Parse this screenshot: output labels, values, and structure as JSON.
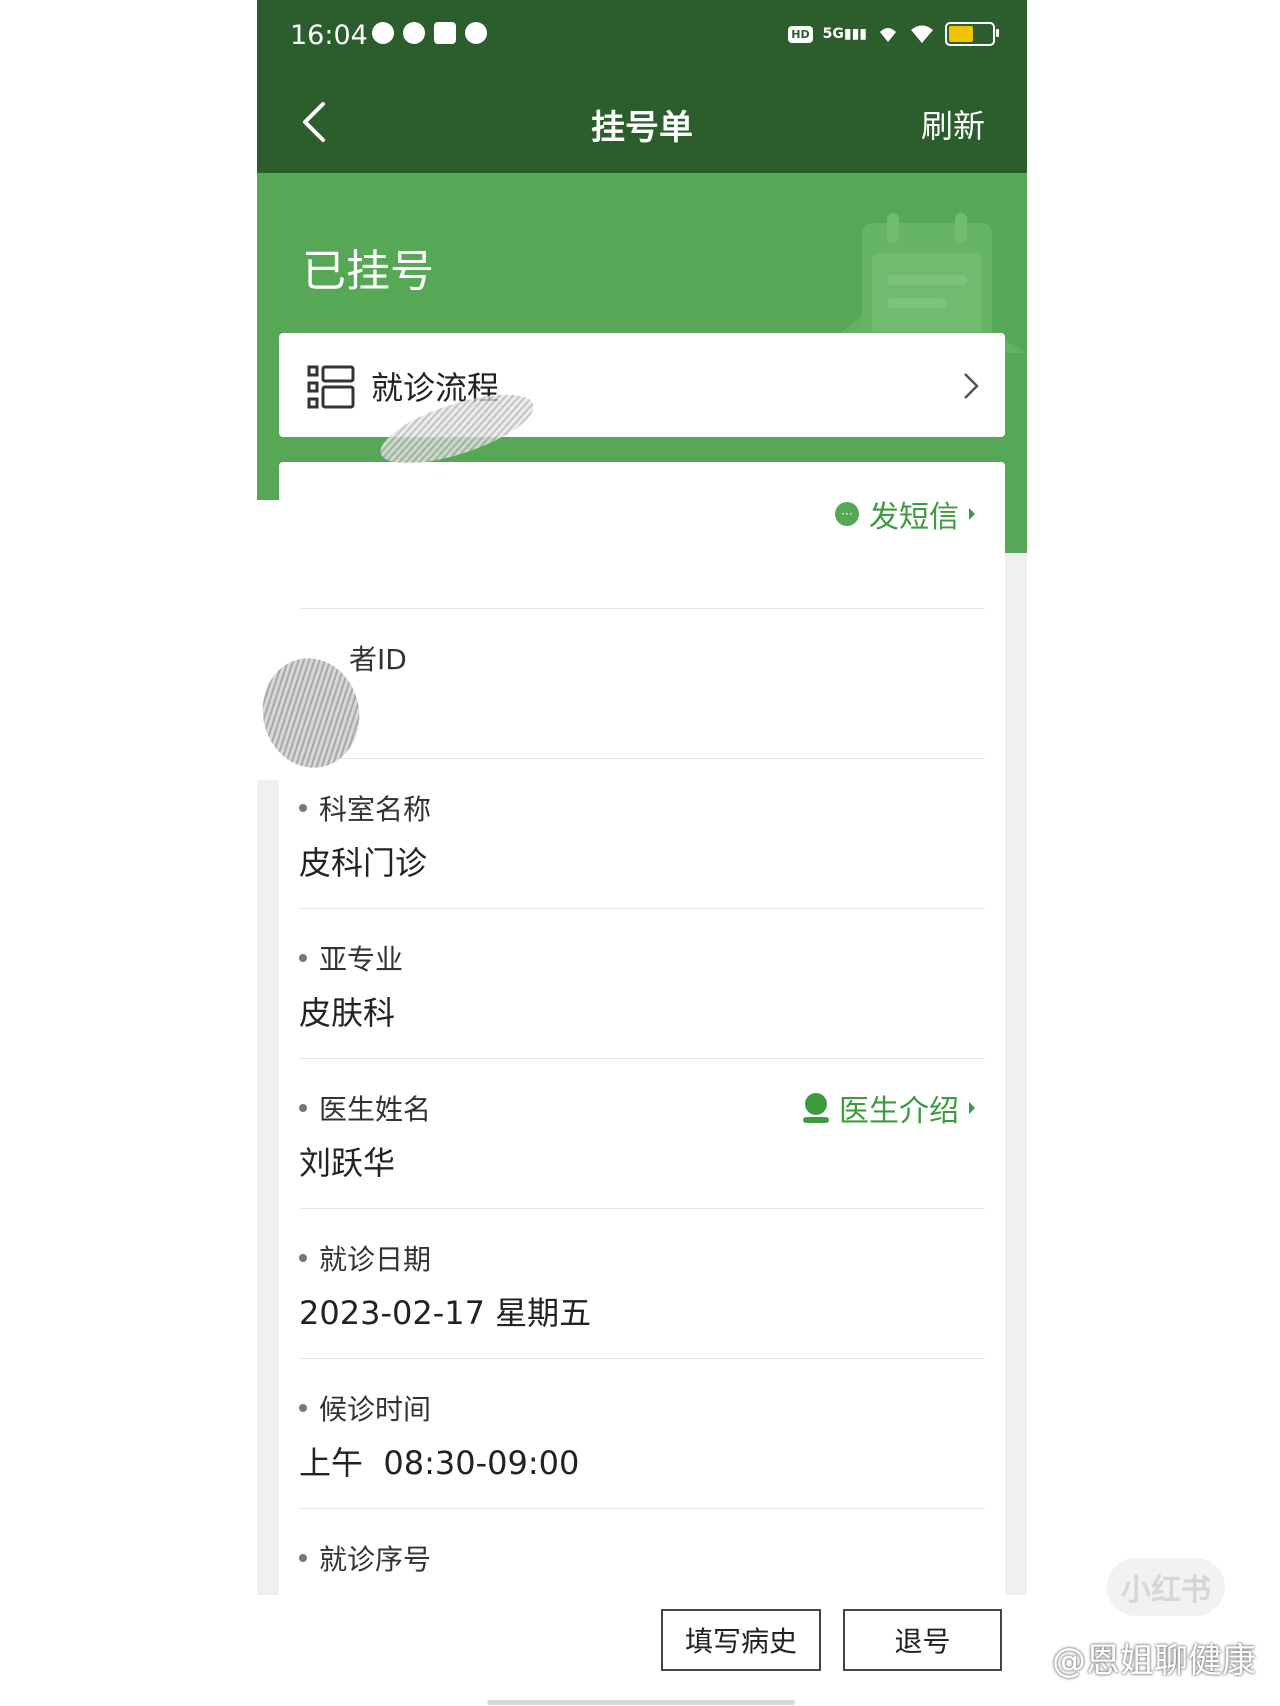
{
  "status_bar": {
    "time": "16:04",
    "hd": "HD",
    "network": "5G"
  },
  "nav": {
    "title": "挂号单",
    "refresh_label": "刷新"
  },
  "hero": {
    "title": "已挂号"
  },
  "flow": {
    "label": "就诊流程"
  },
  "sms": {
    "label": "发短信"
  },
  "patient_id": {
    "label": "者ID"
  },
  "fields": {
    "department": {
      "label": "科室名称",
      "value": "皮科门诊"
    },
    "subspecialty": {
      "label": "亚专业",
      "value": "皮肤科"
    },
    "doctor": {
      "label": "医生姓名",
      "value": "刘跃华",
      "link": "医生介绍"
    },
    "date": {
      "label": "就诊日期",
      "value": "2023-02-17 星期五"
    },
    "wait_time": {
      "label": "候诊时间",
      "value": "上午  08:30-09:00"
    },
    "queue_no": {
      "label": "就诊序号"
    }
  },
  "buttons": {
    "history": "填写病史",
    "cancel": "退号"
  },
  "watermark": {
    "logo": "小红书",
    "handle": "@恩姐聊健康"
  },
  "colors": {
    "nav_bg": "#2c5d2c",
    "hero_bg": "#56a856",
    "accent": "#3d9a3d"
  }
}
